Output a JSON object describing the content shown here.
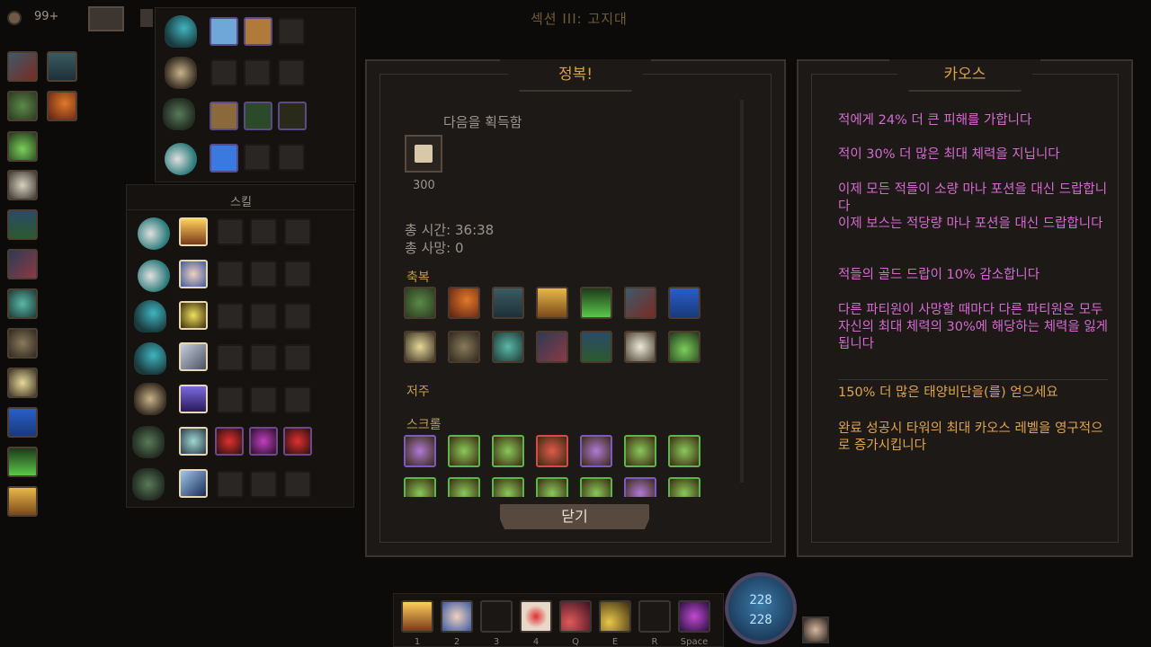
{
  "topbar": {
    "gold_count": "99+",
    "section_title": "섹션 III: 고지대"
  },
  "skill_panel": {
    "title": "스킬"
  },
  "conquest": {
    "title": "정복!",
    "reward_label": "다음을 획득함",
    "reward_amount": "300",
    "total_time": "총 시간: 36:38",
    "total_deaths": "총 사망: 0",
    "blessing_label": "축복",
    "curse_label": "저주",
    "scroll_label": "스크롤",
    "close_button": "닫기"
  },
  "chaos": {
    "title": "카오스",
    "lines": [
      "적에게 24% 더 큰 피해를 가합니다",
      "적이 30% 더 많은 최대 체력을 지닙니다",
      "이제 모든 적들이 소량 마나 포션을 대신 드랍합니다",
      "이제 보스는 적당량 마나 포션을 대신 드랍합니다",
      "적들의 골드 드랍이 10% 감소합니다",
      "다른 파티원이 사망할 때마다 다른 파티원은 모두 자신의 최대 체력의 30%에 해당하는 체력을 잃게됩니다",
      "150% 더 많은 태양비단을(를) 얻으세요",
      "완료 성공시 타워의 최대 카오스 레벨을 영구적으로 증가시킵니다"
    ]
  },
  "hotbar": {
    "keys": [
      "1",
      "2",
      "3",
      "4",
      "Q",
      "E",
      "R",
      "Space"
    ],
    "mana_current": "228",
    "mana_max": "228"
  },
  "colors": {
    "accent_gold": "#d9a14b",
    "chaos_pink": "#d56bd0",
    "chaos_gold": "#e0a44e",
    "panel_border": "#3a342e"
  },
  "icons": {
    "left_column": [
      "demon-mask-icon",
      "armored-knight-icon",
      "leaf-crest-icon",
      "fire-comet-icon",
      "green-potion-icon",
      "bone-tree-icon",
      "green-vine-icon",
      "sword-slash-icon",
      "teal-crystal-icon",
      "root-icon",
      "lightning-icon",
      "blue-banner-icon",
      "grass-icon",
      "holy-cross-icon"
    ]
  }
}
